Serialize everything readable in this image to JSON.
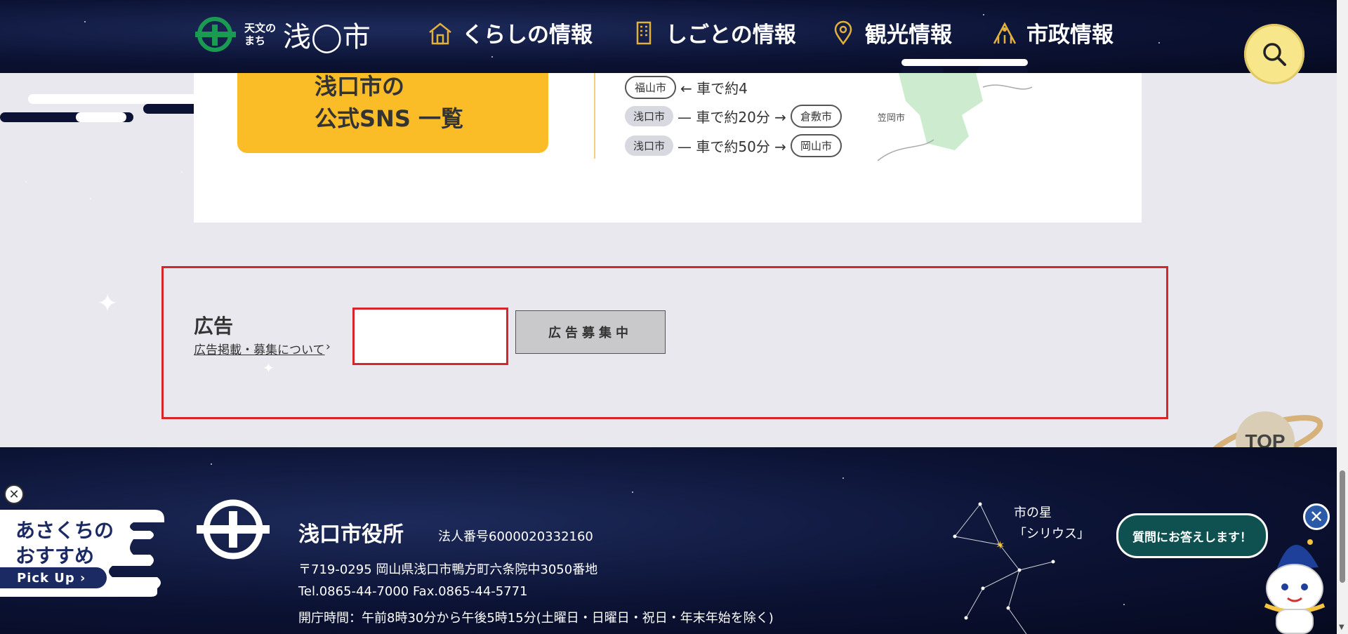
{
  "header": {
    "logo_small_top": "天文の",
    "logo_small_bottom": "まち",
    "logo_big": "浅◯市",
    "nav": [
      {
        "label": "くらしの情報",
        "icon": "house-icon"
      },
      {
        "label": "しごとの情報",
        "icon": "building-icon"
      },
      {
        "label": "観光情報",
        "icon": "map-pin-icon"
      },
      {
        "label": "市政情報",
        "icon": "city-hall-icon"
      }
    ],
    "search_icon": "search-icon"
  },
  "sns": {
    "line1": "浅口市の",
    "line2": "公式SNS 一覧"
  },
  "routes": [
    {
      "from": "福山市",
      "connector": "← 車で約4",
      "to": ""
    },
    {
      "from": "浅口市",
      "connector": "— 車で約20分 →",
      "to": "倉敷市"
    },
    {
      "from": "浅口市",
      "connector": "— 車で約50分 →",
      "to": "岡山市"
    }
  ],
  "map_label": "笠岡市",
  "ad": {
    "title": "広告",
    "link": "広告掲載・募集について",
    "recruiting": "広告募集中"
  },
  "top_button": "TOP",
  "footer": {
    "office_name": "浅口市役所",
    "corp_no": "法人番号6000020332160",
    "address": "〒719-0295  岡山県浅口市鴨方町六条院中3050番地",
    "telfax": "Tel.0865-44-7000  Fax.0865-44-5771",
    "hours": "開庁時間：午前8時30分から午後5時15分(土曜日・日曜日・祝日・年末年始を除く)",
    "star_label_1": "市の星",
    "star_label_2": "「シリウス」"
  },
  "pickup": {
    "line1": "あさくちの",
    "line2": "おすすめ",
    "button": "Pick Up  ›",
    "close": "✕"
  },
  "chat": {
    "bubble": "質問にお答えします！",
    "close": "✕"
  },
  "colors": {
    "night": "#0b1233",
    "accent_yellow": "#fbbd27",
    "highlight_red": "#d6262b",
    "brand_green": "#1a9b52"
  }
}
